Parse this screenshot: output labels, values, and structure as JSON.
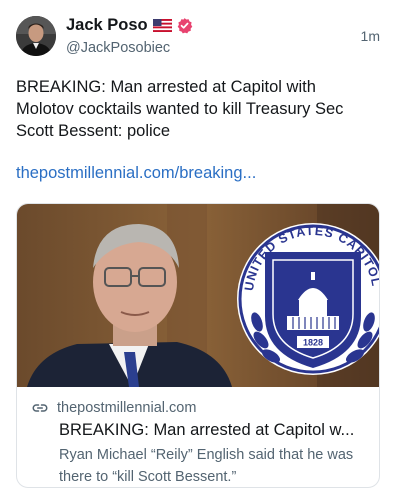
{
  "post": {
    "display_name": "Jack Poso",
    "handle": "@JackPosobiec",
    "time": "1m",
    "text": "BREAKING: Man arrested at Capitol with Molotov cocktails wanted to kill Treasury Sec Scott Bessent: police",
    "link": "thepostmillennial.com/breaking..."
  },
  "card": {
    "domain": "thepostmillennial.com",
    "title": "BREAKING: Man arrested at Capitol w...",
    "description": "Ryan Michael “Reily” English said that he was there to “kill Scott Bessent.”",
    "seal": {
      "ring_text": "UNITED STATES CAPITOL POLICE",
      "year": "1828"
    }
  },
  "icons": {
    "flag": "us-flag-icon",
    "verified": "verified-badge-icon",
    "link": "link-icon"
  },
  "colors": {
    "link": "#2b6fc4",
    "verified": "#e8426f",
    "secondary_text": "#536471"
  }
}
